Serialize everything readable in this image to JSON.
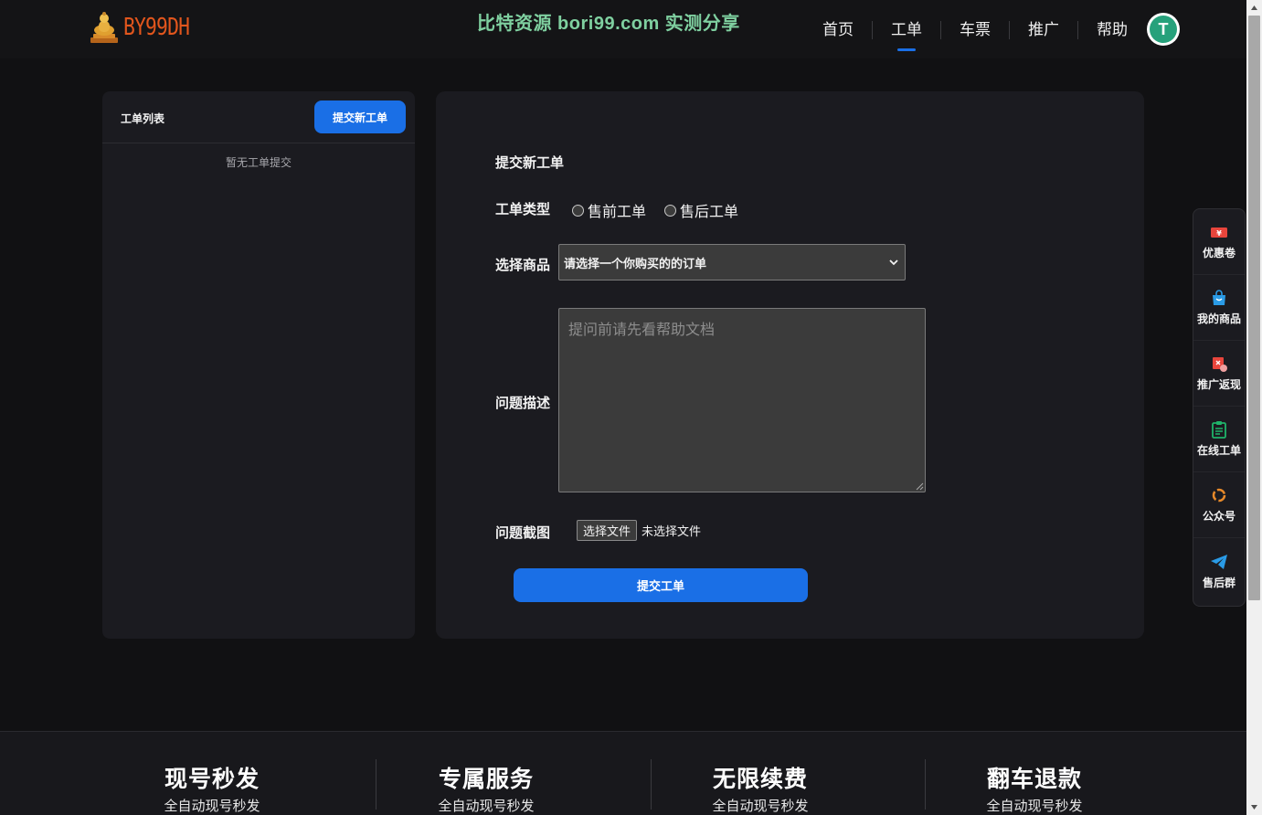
{
  "header": {
    "logo_text": "BY99DH",
    "banner_text": "比特资源 bori99.com 实测分享",
    "nav": [
      {
        "label": "首页"
      },
      {
        "label": "工单"
      },
      {
        "label": "车票"
      },
      {
        "label": "推广"
      },
      {
        "label": "帮助"
      }
    ],
    "active_nav": "工单",
    "avatar_glyph": "T"
  },
  "ticket_list": {
    "title": "工单列表",
    "new_button": "提交新工单",
    "empty_text": "暂无工单提交"
  },
  "form": {
    "title": "提交新工单",
    "type_label": "工单类型",
    "type_options": [
      "售前工单",
      "售后工单"
    ],
    "product_label": "选择商品",
    "product_selected": "请选择一个你购买的的订单",
    "description_label": "问题描述",
    "description_placeholder": "提问前请先看帮助文档",
    "screenshot_label": "问题截图",
    "file_button": "选择文件",
    "file_status": "未选择文件",
    "submit_button": "提交工单"
  },
  "floating_menu": [
    {
      "label": "优惠卷",
      "icon": "coupon-icon",
      "color": "#e8453c"
    },
    {
      "label": "我的商品",
      "icon": "shopping-bag-icon",
      "color": "#2a9be6"
    },
    {
      "label": "推广返现",
      "icon": "gift-icon",
      "color": "#e8453c"
    },
    {
      "label": "在线工单",
      "icon": "clipboard-icon",
      "color": "#1fb46a"
    },
    {
      "label": "公众号",
      "icon": "wechat-official-icon",
      "color": "#e88a2a"
    },
    {
      "label": "售后群",
      "icon": "telegram-icon",
      "color": "#2a9be6"
    }
  ],
  "footer_features": [
    {
      "title": "现号秒发",
      "subtitle": "全自动现号秒发"
    },
    {
      "title": "专属服务",
      "subtitle": "全自动现号秒发"
    },
    {
      "title": "无限续费",
      "subtitle": "全自动现号秒发"
    },
    {
      "title": "翻车退款",
      "subtitle": "全自动现号秒发"
    }
  ],
  "colors": {
    "accent": "#1a6fe6",
    "background": "#111113",
    "panel": "#1b1b20",
    "logo": "#e2561d",
    "banner": "#7fd0a0"
  }
}
